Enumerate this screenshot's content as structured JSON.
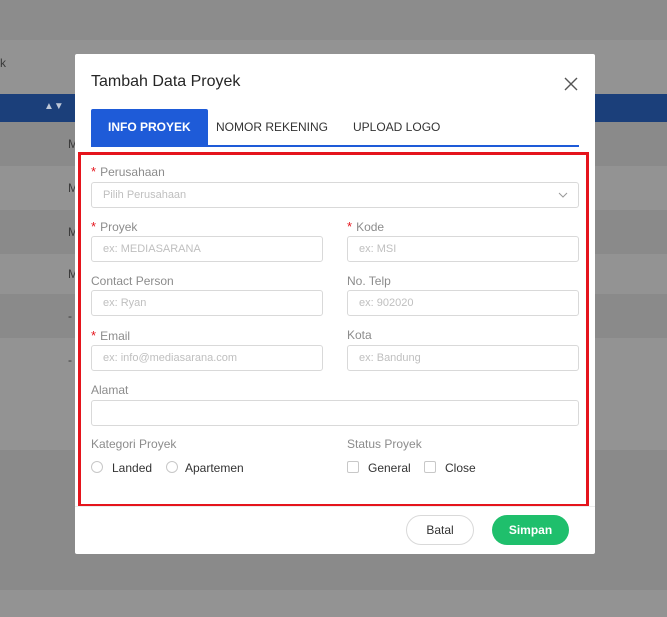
{
  "background": {
    "left_fragment": "k",
    "row_letters": [
      "M",
      "M",
      "M",
      "M",
      "-",
      "-"
    ]
  },
  "modal": {
    "title": "Tambah Data Proyek",
    "tabs": [
      {
        "label": "INFO PROYEK",
        "active": true
      },
      {
        "label": "NOMOR REKENING",
        "active": false
      },
      {
        "label": "UPLOAD LOGO",
        "active": false
      }
    ],
    "form": {
      "perusahaan": {
        "label": "Perusahaan",
        "placeholder": "Pilih Perusahaan",
        "required": "*"
      },
      "proyek": {
        "label": "Proyek",
        "placeholder": "ex: MEDIASARANA",
        "required": "*"
      },
      "kode": {
        "label": "Kode",
        "placeholder": "ex: MSI",
        "required": "*"
      },
      "contact_person": {
        "label": "Contact Person",
        "placeholder": "ex: Ryan"
      },
      "no_telp": {
        "label": "No. Telp",
        "placeholder": "ex: 902020"
      },
      "email": {
        "label": "Email",
        "placeholder": "ex: info@mediasarana.com",
        "required": "*"
      },
      "kota": {
        "label": "Kota",
        "placeholder": "ex: Bandung"
      },
      "alamat": {
        "label": "Alamat",
        "placeholder": ""
      },
      "kategori": {
        "label": "Kategori Proyek",
        "options": [
          "Landed",
          "Apartemen"
        ]
      },
      "status": {
        "label": "Status Proyek",
        "options": [
          "General",
          "Close"
        ]
      }
    },
    "buttons": {
      "cancel": "Batal",
      "submit": "Simpan"
    }
  },
  "colors": {
    "primary": "#1e5bd8",
    "highlight_border": "#e5141c",
    "submit": "#1fbf6c"
  }
}
